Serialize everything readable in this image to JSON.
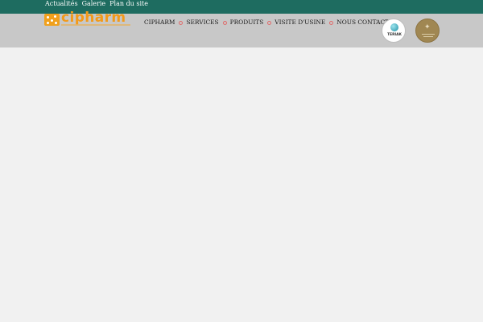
{
  "topbar": {
    "links": [
      "Actualités",
      "Galerie",
      "Plan du site"
    ]
  },
  "header": {
    "logo_text": "cipharm",
    "nav": [
      "CIPHARM",
      "SERVICES",
      "PRODUITS",
      "VISITE D'USINE",
      "NOUS CONTACTER"
    ],
    "partner_logo_text": "TERIAK"
  },
  "colors": {
    "topbar": "#1e6c60",
    "header": "#c8c8c8",
    "background": "#f1f1f1",
    "brand_orange": "#f29a1a",
    "nav_separator": "#e06a6a"
  },
  "icons": {
    "logo_mark": "molecule-icon",
    "nav_separator": "circle-bullet-icon",
    "partner_badge": "teriak-logo",
    "quality_badge": "gold-seal-logo"
  }
}
